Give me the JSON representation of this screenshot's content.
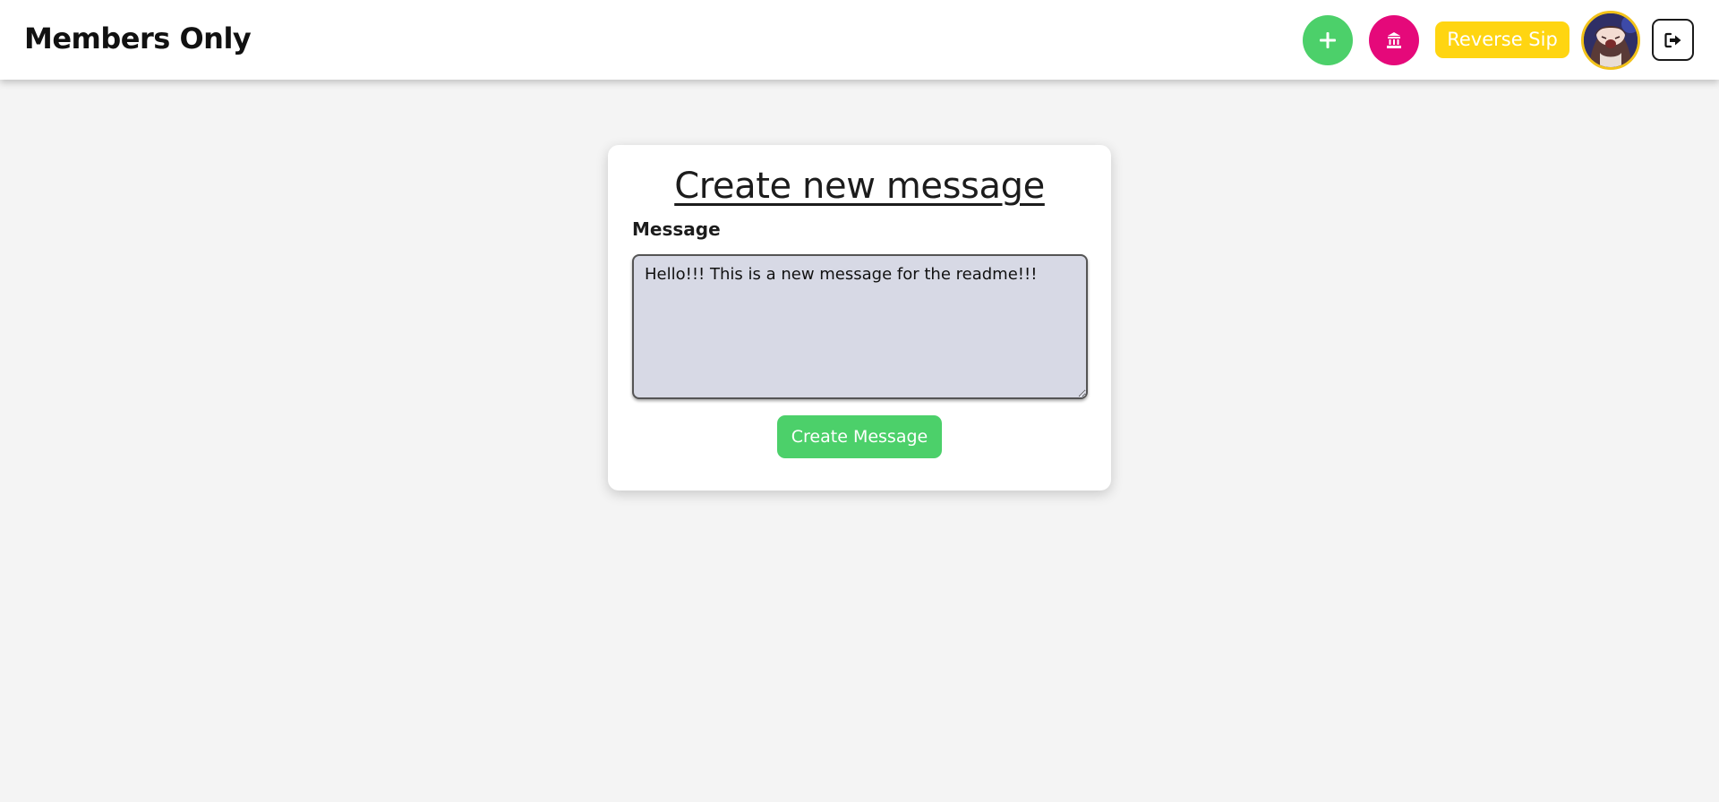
{
  "app": {
    "title": "Members Only"
  },
  "header": {
    "add_icon": "plus-icon",
    "membership_icon": "temple-icon",
    "reverse_button_label": "Reverse Sip",
    "logout_icon": "sign-out-icon",
    "colors": {
      "add": "#4cd06a",
      "membership": "#e5097a",
      "reverse": "#ffd511"
    }
  },
  "form": {
    "title": "Create new message",
    "message_label": "Message",
    "message_value": "Hello!!! This is a new message for the readme!!!",
    "submit_label": "Create Message"
  }
}
